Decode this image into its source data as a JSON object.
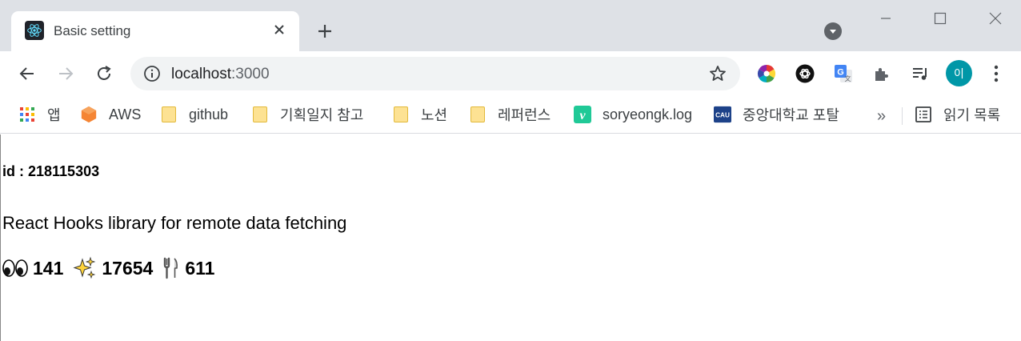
{
  "tab": {
    "title": "Basic setting"
  },
  "omnibox": {
    "host": "localhost",
    "port": ":3000"
  },
  "profile": {
    "initial": "이"
  },
  "bookmarks": [
    {
      "label": "앱",
      "icon": "apps-grid-icon"
    },
    {
      "label": "AWS",
      "icon": "aws-icon"
    },
    {
      "label": "github",
      "icon": "folder-icon"
    },
    {
      "label": "기획일지 참고",
      "icon": "folder-icon"
    },
    {
      "label": "노션",
      "icon": "folder-icon"
    },
    {
      "label": "레퍼런스",
      "icon": "folder-icon"
    },
    {
      "label": "soryeongk.log",
      "icon": "velog-icon"
    },
    {
      "label": "중앙대학교 포탈",
      "icon": "cau-icon"
    }
  ],
  "bookmarks_more": "»",
  "reading_list": {
    "label": "읽기 목록"
  },
  "page": {
    "id_line": "id : 218115303",
    "description": "React Hooks library for remote data fetching",
    "stats": {
      "subscribers": "141",
      "stars": "17654",
      "forks": "611"
    }
  }
}
